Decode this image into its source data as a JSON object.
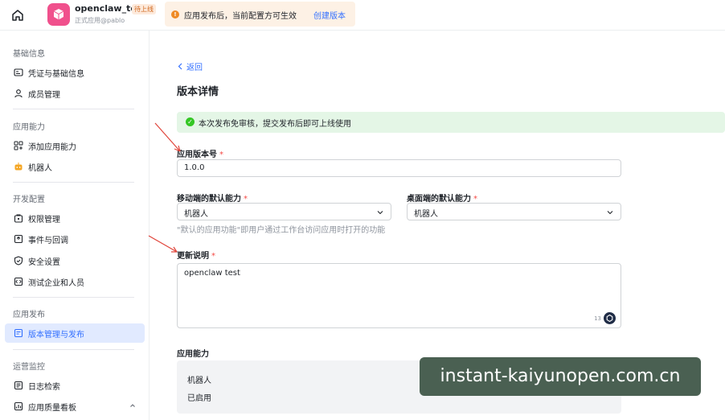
{
  "topbar": {
    "app_name": "openclaw_test",
    "app_tag": "待上线",
    "app_subtitle": "正式应用@pablo",
    "notice_text": "应用发布后，当前配置方可生效",
    "notice_link": "创建版本",
    "logo_color": "#f0508c"
  },
  "sidebar": {
    "sections": [
      {
        "title": "基础信息",
        "items": [
          {
            "label": "凭证与基础信息",
            "icon": "credential-icon"
          },
          {
            "label": "成员管理",
            "icon": "member-icon"
          }
        ]
      },
      {
        "title": "应用能力",
        "items": [
          {
            "label": "添加应用能力",
            "icon": "add-capability-icon"
          },
          {
            "label": "机器人",
            "icon": "robot-icon"
          }
        ]
      },
      {
        "title": "开发配置",
        "items": [
          {
            "label": "权限管理",
            "icon": "permission-icon"
          },
          {
            "label": "事件与回调",
            "icon": "event-icon"
          },
          {
            "label": "安全设置",
            "icon": "shield-icon"
          },
          {
            "label": "测试企业和人员",
            "icon": "test-icon"
          }
        ]
      },
      {
        "title": "应用发布",
        "items": [
          {
            "label": "版本管理与发布",
            "icon": "version-icon",
            "active": true
          }
        ]
      },
      {
        "title": "运营监控",
        "items": [
          {
            "label": "日志检索",
            "icon": "log-icon"
          },
          {
            "label": "应用质量看板",
            "icon": "dashboard-icon"
          }
        ]
      }
    ]
  },
  "main": {
    "back_label": "返回",
    "page_title": "版本详情",
    "success_text": "本次发布免审核，提交发布后即可上线使用",
    "version_label": "应用版本号",
    "version_value": "1.0.0",
    "mobile_label": "移动端的默认能力",
    "mobile_value": "机器人",
    "desktop_label": "桌面端的默认能力",
    "desktop_value": "机器人",
    "hint": "\"默认的应用功能\"即用户通过工作台访问应用时打开的功能",
    "notes_label": "更新说明",
    "notes_value": "openclaw test",
    "notes_count": "13",
    "capability_label": "应用能力",
    "capability_name": "机器人",
    "capability_status": "已启用",
    "required_mark": "*"
  },
  "watermark": "instant-kaiyunopen.com.cn",
  "colors": {
    "accent": "#3370ff",
    "success": "#34c724",
    "warning": "#ef8a25",
    "arrow": "#e0443a"
  }
}
